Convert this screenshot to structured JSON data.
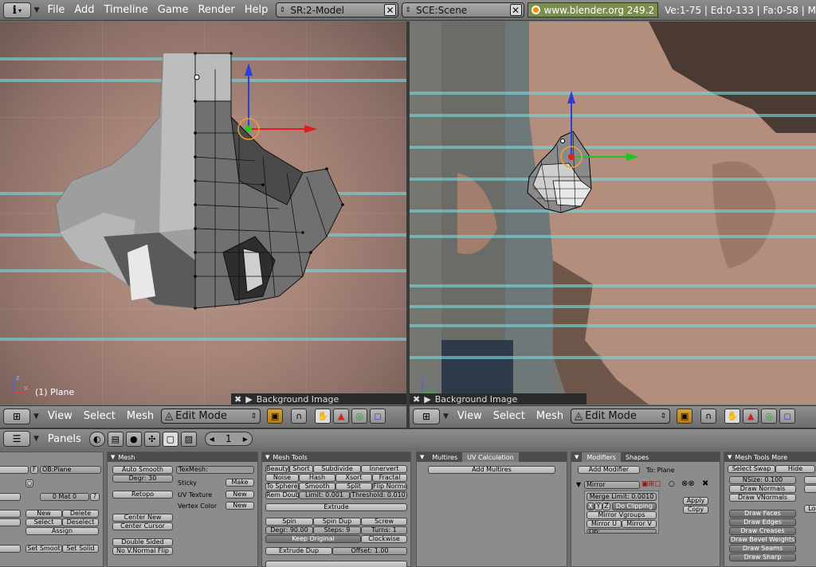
{
  "topbar": {
    "menus": [
      "File",
      "Add",
      "Timeline",
      "Game",
      "Render",
      "Help"
    ],
    "screen": "SR:2-Model",
    "scene": "SCE:Scene",
    "url": "www.blender.org 249.2",
    "stats": "Ve:1-75 | Ed:0-133 | Fa:0-58 | M"
  },
  "viewport_left": {
    "object_label": "(1) Plane",
    "bg_label": "Background Image"
  },
  "viewport_right": {
    "bg_label": "Background Image"
  },
  "viewport_header": {
    "menus": [
      "View",
      "Select",
      "Mesh"
    ],
    "mode": "Edit Mode"
  },
  "panels_header": {
    "label": "Panels",
    "page": "1"
  },
  "panel_link": {
    "ob": "OB:Plane",
    "mat": "0 Mat 0",
    "new": "New",
    "delete": "Delete",
    "select": "Select",
    "deselect": "Deselect",
    "assign": "Assign",
    "set_smooth": "Set Smoot",
    "set_solid": "Set Solid"
  },
  "panel_mesh": {
    "title": "Mesh",
    "auto_smooth": "Auto Smooth",
    "degr": "Degr: 30",
    "retopo": "Retopo",
    "center_new": "Center New",
    "center_cursor": "Center Cursor",
    "double_sided": "Double Sided",
    "no_vnormal_flip": "No V.Normal Flip",
    "texmesh": "TexMesh:",
    "sticky": "Sticky",
    "uv_texture": "UV Texture",
    "vertex_color": "Vertex Color",
    "make": "Make",
    "new1": "New",
    "new2": "New",
    "center": "Center"
  },
  "panel_meshtools": {
    "title": "Mesh Tools",
    "row1": [
      "Beauty",
      "Short",
      "Subdivide",
      "Innervert"
    ],
    "row2": [
      "Noise",
      "Hash",
      "Xsort",
      "Fractal"
    ],
    "row3": [
      "To Sphere",
      "Smooth",
      "Split",
      "Flip Normal"
    ],
    "rem_doubl": "Rem Doubl",
    "limit": "Limit: 0.001",
    "threshold": "Threshold: 0.010",
    "extrude": "Extrude",
    "spin": "Spin",
    "spin_dup": "Spin Dup",
    "screw": "Screw",
    "degr": "Degr: 90.00",
    "steps": "Steps: 9",
    "turns": "Turns: 1",
    "keep_original": "Keep Original",
    "clockwise": "Clockwise",
    "extrude_dup": "Extrude Dup",
    "offset": "Offset: 1.00"
  },
  "panel_multires": {
    "tab1": "Multires",
    "tab2": "UV Calculation",
    "add_multires": "Add Multires"
  },
  "panel_modifiers": {
    "tab1": "Modifiers",
    "tab2": "Shapes",
    "add_modifier": "Add Modifier",
    "to_plane": "To: Plane",
    "mirror": "Mirror",
    "merge_limit": "Merge Limit: 0.0010",
    "x": "X",
    "y": "Y",
    "z": "Z",
    "do_clipping": "Do Clipping",
    "mirror_vgroups": "Mirror Vgroups",
    "mirror_u": "Mirror U",
    "mirror_v": "Mirror V",
    "ob": "Ob:",
    "apply": "Apply",
    "copy": "Copy"
  },
  "panel_more": {
    "title": "Mesh Tools More",
    "select_swap": "Select Swap",
    "hide": "Hide",
    "nsize": "NSize: 0.100",
    "draw_normals": "Draw Normals",
    "draw_vnormals": "Draw VNormals",
    "draw_faces": "Draw Faces",
    "draw_edges": "Draw Edges",
    "draw_creases": "Draw Creases",
    "draw_bevel_weights": "Draw Bevel Weights",
    "draw_seams": "Draw Seams",
    "draw_sharp": "Draw Sharp",
    "lo": "Lo"
  }
}
